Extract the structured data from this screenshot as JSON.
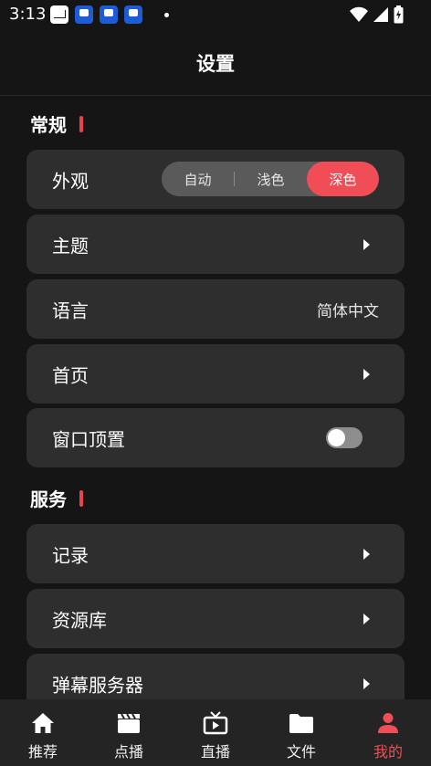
{
  "status_bar": {
    "time": "3:13"
  },
  "header": {
    "title": "设置"
  },
  "sections": {
    "general": "常规",
    "services": "服务"
  },
  "appearance": {
    "label": "外观",
    "options": [
      "自动",
      "浅色",
      "深色"
    ],
    "selected": "深色"
  },
  "theme": {
    "label": "主题"
  },
  "language": {
    "label": "语言",
    "value": "简体中文"
  },
  "home": {
    "label": "首页"
  },
  "pin_window": {
    "label": "窗口顶置",
    "enabled": false
  },
  "history": {
    "label": "记录"
  },
  "library": {
    "label": "资源库"
  },
  "danmaku": {
    "label": "弹幕服务器"
  },
  "tabs": [
    "推荐",
    "点播",
    "直播",
    "文件",
    "我的"
  ],
  "active_tab": "我的",
  "colors": {
    "accent": "#f04d57",
    "background": "#151515",
    "card": "#2e2e2e",
    "tabbar": "#242424"
  }
}
